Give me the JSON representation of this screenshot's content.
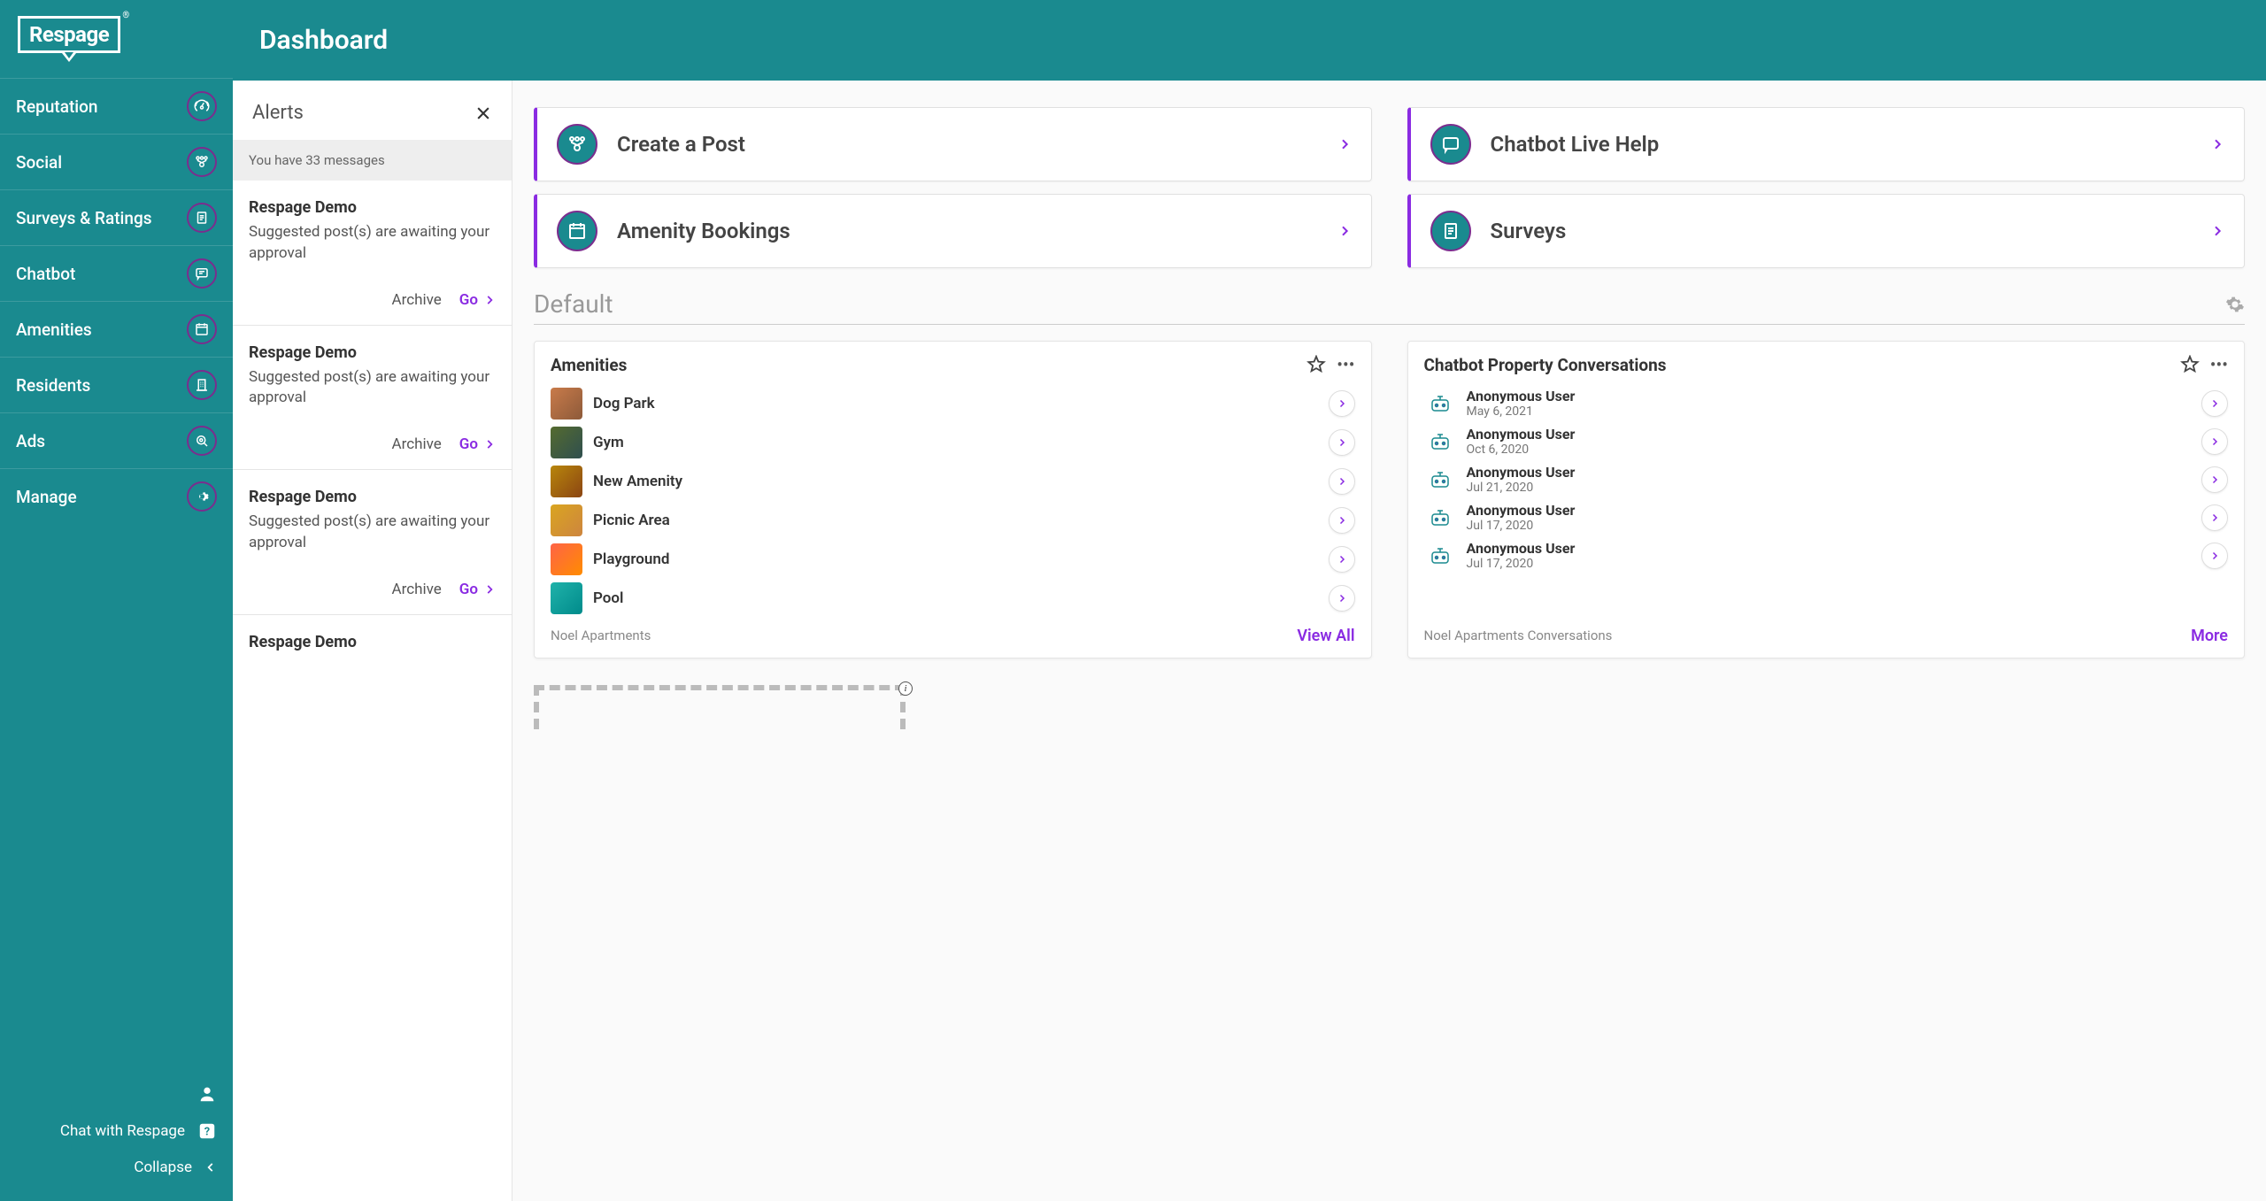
{
  "brand": "Respage",
  "page_title": "Dashboard",
  "sidebar": {
    "items": [
      {
        "label": "Reputation",
        "icon": "gauge"
      },
      {
        "label": "Social",
        "icon": "network"
      },
      {
        "label": "Surveys & Ratings",
        "icon": "clipboard"
      },
      {
        "label": "Chatbot",
        "icon": "chat"
      },
      {
        "label": "Amenities",
        "icon": "calendar"
      },
      {
        "label": "Residents",
        "icon": "building"
      },
      {
        "label": "Ads",
        "icon": "target"
      },
      {
        "label": "Manage",
        "icon": "gear"
      }
    ],
    "chat_label": "Chat with Respage",
    "collapse_label": "Collapse"
  },
  "alerts": {
    "title": "Alerts",
    "sub": "You have 33 messages",
    "archive_label": "Archive",
    "go_label": "Go",
    "items": [
      {
        "title": "Respage Demo",
        "body": "Suggested post(s) are awaiting your approval"
      },
      {
        "title": "Respage Demo",
        "body": "Suggested post(s) are awaiting your approval"
      },
      {
        "title": "Respage Demo",
        "body": "Suggested post(s) are awaiting your approval"
      },
      {
        "title": "Respage Demo",
        "body": ""
      }
    ]
  },
  "quick": [
    {
      "label": "Create a Post",
      "icon": "network"
    },
    {
      "label": "Chatbot Live Help",
      "icon": "chat"
    },
    {
      "label": "Amenity Bookings",
      "icon": "calendar"
    },
    {
      "label": "Surveys",
      "icon": "clipboard"
    }
  ],
  "section": {
    "title": "Default"
  },
  "amenities_widget": {
    "title": "Amenities",
    "items": [
      {
        "name": "Dog Park",
        "cls": "dog"
      },
      {
        "name": "Gym",
        "cls": "gym"
      },
      {
        "name": "New Amenity",
        "cls": "new"
      },
      {
        "name": "Picnic Area",
        "cls": "picnic"
      },
      {
        "name": "Playground",
        "cls": "play"
      },
      {
        "name": "Pool",
        "cls": "pool"
      }
    ],
    "footer_left": "Noel Apartments",
    "footer_right": "View All"
  },
  "conversations_widget": {
    "title": "Chatbot Property Conversations",
    "items": [
      {
        "name": "Anonymous User",
        "date": "May 6, 2021"
      },
      {
        "name": "Anonymous User",
        "date": "Oct 6, 2020"
      },
      {
        "name": "Anonymous User",
        "date": "Jul 21, 2020"
      },
      {
        "name": "Anonymous User",
        "date": "Jul 17, 2020"
      },
      {
        "name": "Anonymous User",
        "date": "Jul 17, 2020"
      }
    ],
    "footer_left": "Noel Apartments Conversations",
    "footer_right": "More"
  }
}
